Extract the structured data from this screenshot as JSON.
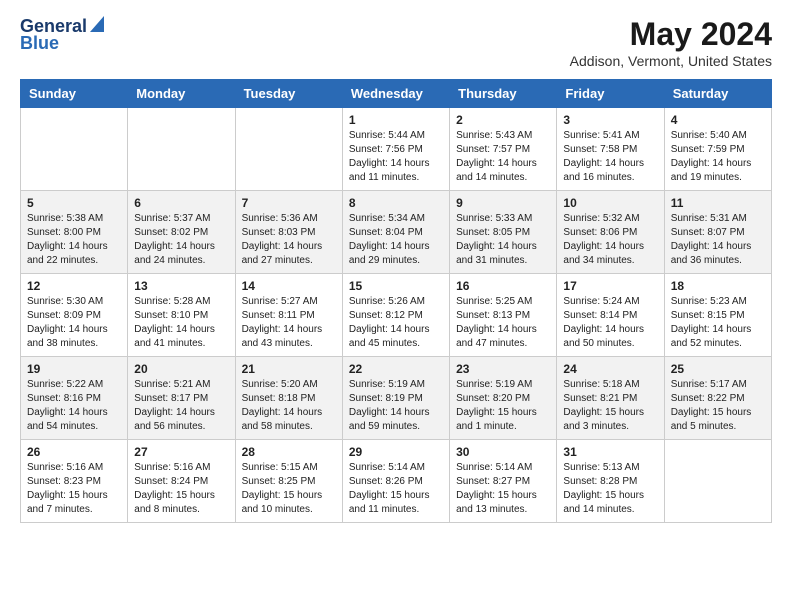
{
  "header": {
    "logo_general": "General",
    "logo_blue": "Blue",
    "title": "May 2024",
    "subtitle": "Addison, Vermont, United States"
  },
  "days_of_week": [
    "Sunday",
    "Monday",
    "Tuesday",
    "Wednesday",
    "Thursday",
    "Friday",
    "Saturday"
  ],
  "weeks": [
    [
      {
        "day": "",
        "info": ""
      },
      {
        "day": "",
        "info": ""
      },
      {
        "day": "",
        "info": ""
      },
      {
        "day": "1",
        "info": "Sunrise: 5:44 AM\nSunset: 7:56 PM\nDaylight: 14 hours\nand 11 minutes."
      },
      {
        "day": "2",
        "info": "Sunrise: 5:43 AM\nSunset: 7:57 PM\nDaylight: 14 hours\nand 14 minutes."
      },
      {
        "day": "3",
        "info": "Sunrise: 5:41 AM\nSunset: 7:58 PM\nDaylight: 14 hours\nand 16 minutes."
      },
      {
        "day": "4",
        "info": "Sunrise: 5:40 AM\nSunset: 7:59 PM\nDaylight: 14 hours\nand 19 minutes."
      }
    ],
    [
      {
        "day": "5",
        "info": "Sunrise: 5:38 AM\nSunset: 8:00 PM\nDaylight: 14 hours\nand 22 minutes."
      },
      {
        "day": "6",
        "info": "Sunrise: 5:37 AM\nSunset: 8:02 PM\nDaylight: 14 hours\nand 24 minutes."
      },
      {
        "day": "7",
        "info": "Sunrise: 5:36 AM\nSunset: 8:03 PM\nDaylight: 14 hours\nand 27 minutes."
      },
      {
        "day": "8",
        "info": "Sunrise: 5:34 AM\nSunset: 8:04 PM\nDaylight: 14 hours\nand 29 minutes."
      },
      {
        "day": "9",
        "info": "Sunrise: 5:33 AM\nSunset: 8:05 PM\nDaylight: 14 hours\nand 31 minutes."
      },
      {
        "day": "10",
        "info": "Sunrise: 5:32 AM\nSunset: 8:06 PM\nDaylight: 14 hours\nand 34 minutes."
      },
      {
        "day": "11",
        "info": "Sunrise: 5:31 AM\nSunset: 8:07 PM\nDaylight: 14 hours\nand 36 minutes."
      }
    ],
    [
      {
        "day": "12",
        "info": "Sunrise: 5:30 AM\nSunset: 8:09 PM\nDaylight: 14 hours\nand 38 minutes."
      },
      {
        "day": "13",
        "info": "Sunrise: 5:28 AM\nSunset: 8:10 PM\nDaylight: 14 hours\nand 41 minutes."
      },
      {
        "day": "14",
        "info": "Sunrise: 5:27 AM\nSunset: 8:11 PM\nDaylight: 14 hours\nand 43 minutes."
      },
      {
        "day": "15",
        "info": "Sunrise: 5:26 AM\nSunset: 8:12 PM\nDaylight: 14 hours\nand 45 minutes."
      },
      {
        "day": "16",
        "info": "Sunrise: 5:25 AM\nSunset: 8:13 PM\nDaylight: 14 hours\nand 47 minutes."
      },
      {
        "day": "17",
        "info": "Sunrise: 5:24 AM\nSunset: 8:14 PM\nDaylight: 14 hours\nand 50 minutes."
      },
      {
        "day": "18",
        "info": "Sunrise: 5:23 AM\nSunset: 8:15 PM\nDaylight: 14 hours\nand 52 minutes."
      }
    ],
    [
      {
        "day": "19",
        "info": "Sunrise: 5:22 AM\nSunset: 8:16 PM\nDaylight: 14 hours\nand 54 minutes."
      },
      {
        "day": "20",
        "info": "Sunrise: 5:21 AM\nSunset: 8:17 PM\nDaylight: 14 hours\nand 56 minutes."
      },
      {
        "day": "21",
        "info": "Sunrise: 5:20 AM\nSunset: 8:18 PM\nDaylight: 14 hours\nand 58 minutes."
      },
      {
        "day": "22",
        "info": "Sunrise: 5:19 AM\nSunset: 8:19 PM\nDaylight: 14 hours\nand 59 minutes."
      },
      {
        "day": "23",
        "info": "Sunrise: 5:19 AM\nSunset: 8:20 PM\nDaylight: 15 hours\nand 1 minute."
      },
      {
        "day": "24",
        "info": "Sunrise: 5:18 AM\nSunset: 8:21 PM\nDaylight: 15 hours\nand 3 minutes."
      },
      {
        "day": "25",
        "info": "Sunrise: 5:17 AM\nSunset: 8:22 PM\nDaylight: 15 hours\nand 5 minutes."
      }
    ],
    [
      {
        "day": "26",
        "info": "Sunrise: 5:16 AM\nSunset: 8:23 PM\nDaylight: 15 hours\nand 7 minutes."
      },
      {
        "day": "27",
        "info": "Sunrise: 5:16 AM\nSunset: 8:24 PM\nDaylight: 15 hours\nand 8 minutes."
      },
      {
        "day": "28",
        "info": "Sunrise: 5:15 AM\nSunset: 8:25 PM\nDaylight: 15 hours\nand 10 minutes."
      },
      {
        "day": "29",
        "info": "Sunrise: 5:14 AM\nSunset: 8:26 PM\nDaylight: 15 hours\nand 11 minutes."
      },
      {
        "day": "30",
        "info": "Sunrise: 5:14 AM\nSunset: 8:27 PM\nDaylight: 15 hours\nand 13 minutes."
      },
      {
        "day": "31",
        "info": "Sunrise: 5:13 AM\nSunset: 8:28 PM\nDaylight: 15 hours\nand 14 minutes."
      },
      {
        "day": "",
        "info": ""
      }
    ]
  ]
}
